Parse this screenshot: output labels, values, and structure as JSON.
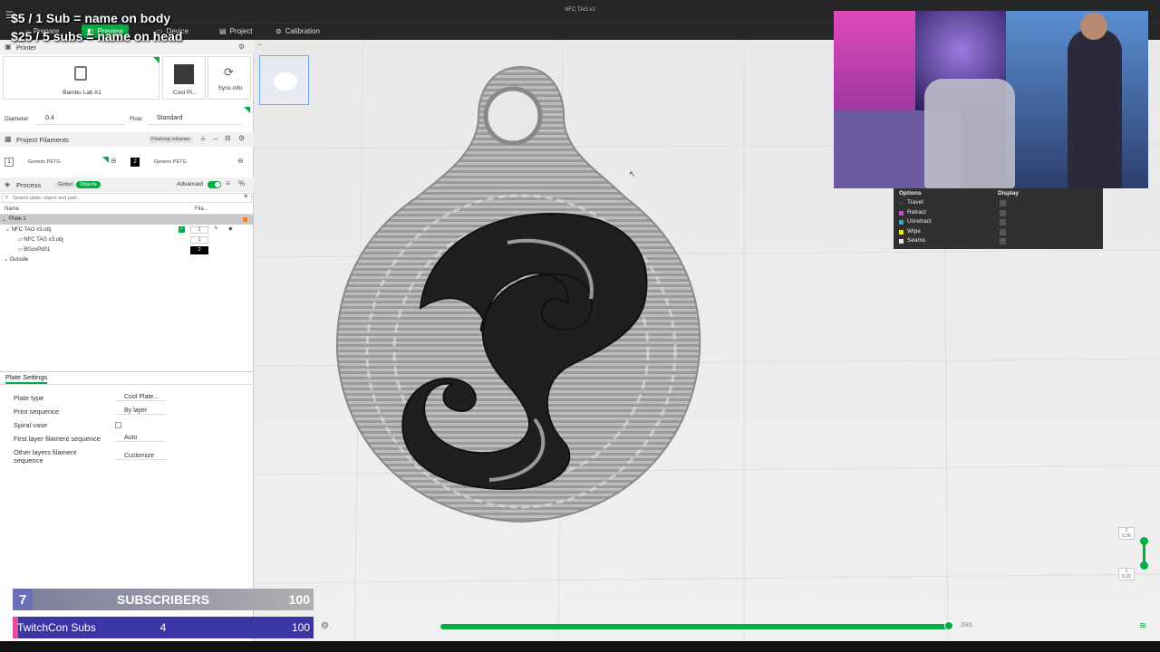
{
  "window": {
    "title": "NFC TAG v2"
  },
  "tabs": [
    {
      "label": "Prepare"
    },
    {
      "label": "Preview"
    },
    {
      "label": "Device"
    },
    {
      "label": "Project"
    },
    {
      "label": "Calibration"
    }
  ],
  "promo": {
    "line1": "$5 / 1 Sub = name on body",
    "line2": "$25 / 5 subs = name on head"
  },
  "printer": {
    "header": "Printer",
    "name": "Bambu Lab A1",
    "plate": "Cool Pl...",
    "sync": "Sync info",
    "diameter_label": "Diameter",
    "diameter_value": "0.4",
    "flow_label": "Flow",
    "flow_value": "Standard"
  },
  "filaments": {
    "header": "Project Filaments",
    "flushing": "Flushing volumes",
    "items": [
      {
        "index": "1",
        "name": "Generic PETG"
      },
      {
        "index": "2",
        "name": "Generic PETG"
      }
    ]
  },
  "process": {
    "header": "Process",
    "global": "Global",
    "objects": "Objects",
    "advanced": "Advanced",
    "search_placeholder": "Search plate, object and part..."
  },
  "tree": {
    "col_name": "Name",
    "col_fil": "Fila...",
    "plate": "Plate 1",
    "object": "NFC TAG v3.obj",
    "part1": "NFC TAG v3.obj",
    "part2": "BGoxPd01",
    "outside": "Outside",
    "part1_fil": "1",
    "part2_fil": "2",
    "object_fil": "1"
  },
  "plate_settings": {
    "header": "Plate Settings",
    "rows": [
      {
        "label": "Plate type",
        "value": "Cool Plate..."
      },
      {
        "label": "Print sequence",
        "value": "By layer"
      },
      {
        "label": "Spiral vase",
        "value": ""
      },
      {
        "label": "First layer filament sequence",
        "value": "Auto"
      },
      {
        "label": "Other layers filament sequence",
        "value": "Customize"
      }
    ]
  },
  "legend": {
    "col_options": "Options",
    "col_display": "Display",
    "items": [
      {
        "label": "Travel",
        "color": "#3a3a3a",
        "checked": false
      },
      {
        "label": "Retract",
        "color": "#d04bd0",
        "checked": false
      },
      {
        "label": "Unretract",
        "color": "#35a9c2",
        "checked": false
      },
      {
        "label": "Wipe",
        "color": "#e8e820",
        "checked": false
      },
      {
        "label": "Seams",
        "color": "#e8e8e8",
        "checked": true
      }
    ]
  },
  "layer_slider": {
    "top_layer": "2",
    "top_height": "0.36",
    "bottom_layer": "1",
    "bottom_height": "0.20"
  },
  "move_slider": {
    "value": "2501"
  },
  "overlay": {
    "subs_count": "7",
    "subs_label": "SUBSCRIBERS",
    "subs_goal": "100",
    "twitchcon_label": "TwitchCon Subs",
    "twitchcon_count": "4",
    "twitchcon_goal": "100"
  },
  "colors": {
    "accent": "#00ae42",
    "dark_bar": "#262626"
  }
}
